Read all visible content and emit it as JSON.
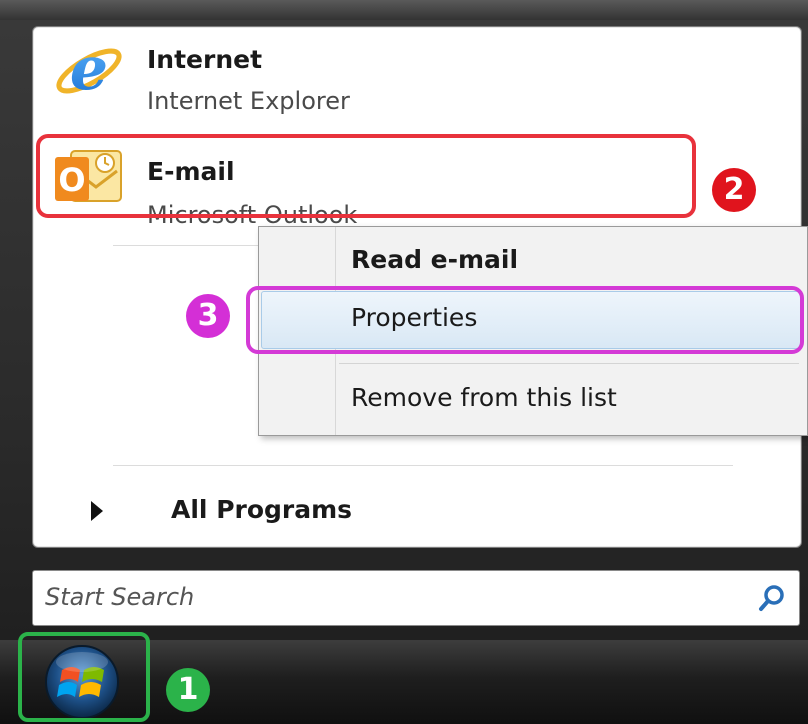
{
  "pinned": {
    "internet": {
      "title": "Internet",
      "subtitle": "Internet Explorer",
      "icon": "internet-explorer-icon"
    },
    "email": {
      "title": "E-mail",
      "subtitle": "Microsoft Outlook",
      "icon": "outlook-icon"
    }
  },
  "context_menu": {
    "read_email": "Read e-mail",
    "properties": "Properties",
    "remove": "Remove from this list"
  },
  "all_programs": {
    "label": "All Programs"
  },
  "search": {
    "placeholder": "Start Search",
    "icon": "search-icon"
  },
  "taskbar": {
    "start_icon": "windows-start-orb-icon"
  },
  "annotations": {
    "step1": "1",
    "step2": "2",
    "step3": "3"
  },
  "colors": {
    "step1": "#2bb34a",
    "step2": "#e0141d",
    "step3": "#d42fd6",
    "selection_bg": "#d9e8f5"
  }
}
